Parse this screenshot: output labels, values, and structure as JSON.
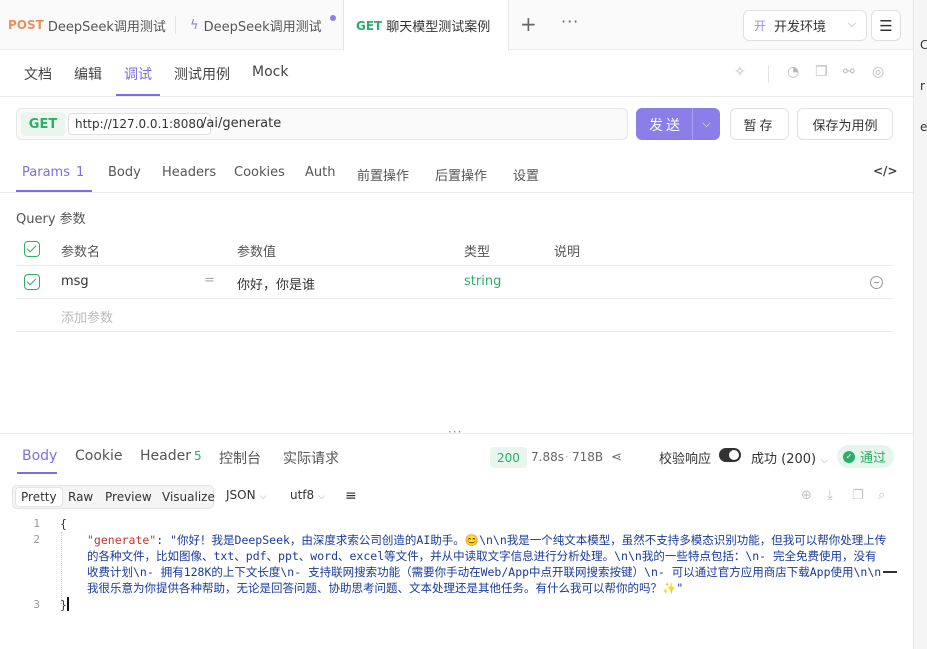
{
  "tabs": [
    {
      "method": "POST",
      "label": "DeepSeek调用测试"
    },
    {
      "method": "",
      "label": "DeepSeek调用测试"
    },
    {
      "method": "GET",
      "label": "聊天模型测试案例"
    }
  ],
  "tab_actions": {
    "add": "+",
    "more": "···"
  },
  "environment": {
    "badge": "开",
    "label": "开发环境"
  },
  "subnav": [
    "文档",
    "编辑",
    "调试",
    "测试用例",
    "Mock"
  ],
  "request": {
    "method": "GET",
    "host": "http://127.0.0.1:8080",
    "path": "/ai/generate",
    "send_label": "发送",
    "save_temp_label": "暂存",
    "save_case_label": "保存为用例"
  },
  "param_tabs": {
    "params_label": "Params",
    "params_count": "1",
    "others": [
      "Body",
      "Headers",
      "Cookies",
      "Auth",
      "前置操作",
      "后置操作",
      "设置"
    ]
  },
  "query": {
    "title": "Query 参数",
    "headers": {
      "name": "参数名",
      "value": "参数值",
      "type": "类型",
      "desc": "说明"
    },
    "rows": [
      {
        "name": "msg",
        "eq": "=",
        "value": "你好，你是谁",
        "type": "string"
      }
    ],
    "add_placeholder": "添加参数"
  },
  "response_tabs": {
    "body": "Body",
    "cookie": "Cookie",
    "header": "Header",
    "header_count": "5",
    "console": "控制台",
    "actual": "实际请求"
  },
  "response_meta": {
    "status": "200",
    "time": "7.88s",
    "size": "718B",
    "validate_label": "校验响应",
    "result_label": "成功 (200)",
    "pass_label": "通过"
  },
  "format": {
    "options": [
      "Pretty",
      "Raw",
      "Preview",
      "Visualize"
    ],
    "lang": "JSON",
    "encoding": "utf8"
  },
  "code": {
    "lines": [
      "1",
      "2",
      "3"
    ],
    "open": "{",
    "key": "\"generate\"",
    "colon": ": ",
    "value": "\"你好！我是DeepSeek，由深度求索公司创造的AI助手。😊\\n\\n我是一个纯文本模型，虽然不支持多模态识别功能，但我可以帮你处理上传的各种文件，比如图像、txt、pdf、ppt、word、excel等文件，并从中读取文字信息进行分析处理。\\n\\n我的一些特点包括：\\n- 完全免费使用，没有收费计划\\n- 拥有128K的上下文长度\\n- 支持联网搜索功能（需要你手动在Web/App中点开联网搜索按键）\\n- 可以通过官方应用商店下载App使用\\n\\n我很乐意为你提供各种帮助，无论是回答问题、协助思考问题、文本处理还是其他任务。有什么我可以帮你的吗？✨\"",
    "close": "}"
  },
  "colors": {
    "accent": "#7b6ee4",
    "success": "#2dad6a",
    "post": "#ef8e5c"
  }
}
